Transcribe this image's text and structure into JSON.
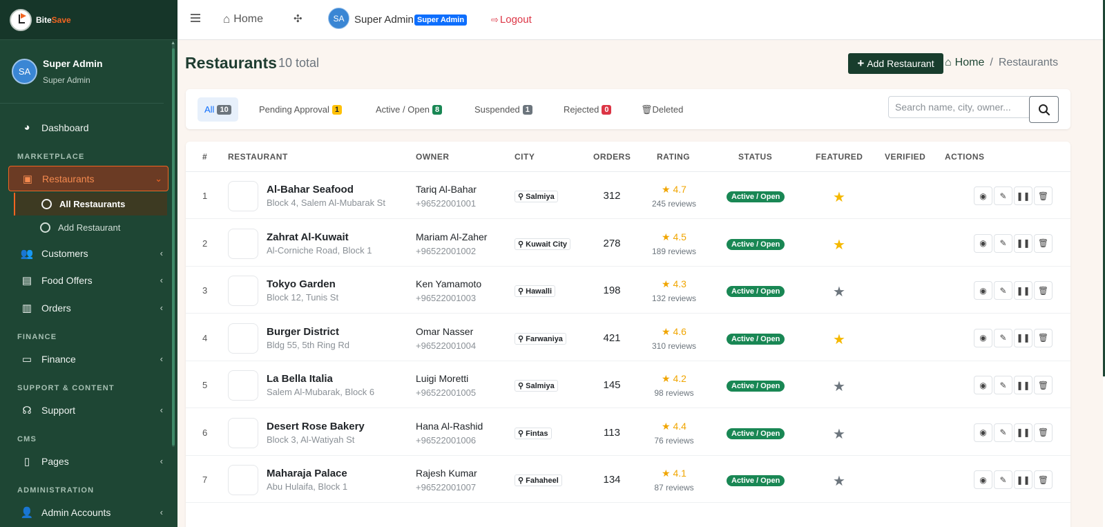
{
  "brand": {
    "name_part1": "Bite",
    "name_part2": "Save"
  },
  "sidebar": {
    "user": {
      "initials": "SA",
      "name": "Super Admin",
      "role": "Super Admin"
    },
    "dashboard": "Dashboard",
    "sections": {
      "marketplace": "MARKETPLACE",
      "finance": "FINANCE",
      "support": "SUPPORT & CONTENT",
      "cms": "CMS",
      "administration": "ADMINISTRATION"
    },
    "items": {
      "restaurants": "Restaurants",
      "all_restaurants": "All Restaurants",
      "add_restaurant": "Add Restaurant",
      "customers": "Customers",
      "food_offers": "Food Offers",
      "orders": "Orders",
      "finance": "Finance",
      "support": "Support",
      "pages": "Pages",
      "admin_accounts": "Admin Accounts"
    }
  },
  "topbar": {
    "home": "Home",
    "user_initials": "SA",
    "user_name": "Super Admin",
    "user_badge": "Super Admin",
    "logout": "Logout"
  },
  "page": {
    "title": "Restaurants",
    "count": "10 total",
    "add_button": "Add Restaurant",
    "breadcrumb": {
      "home": "Home",
      "separator": "/",
      "current": "Restaurants"
    }
  },
  "filters": {
    "tabs": [
      {
        "label": "All",
        "count": "10"
      },
      {
        "label": "Pending Approval",
        "count": "1"
      },
      {
        "label": "Active / Open",
        "count": "8"
      },
      {
        "label": "Suspended",
        "count": "1"
      },
      {
        "label": "Rejected",
        "count": "0"
      },
      {
        "label": "Deleted"
      }
    ],
    "search_placeholder": "Search name, city, owner..."
  },
  "table": {
    "headers": {
      "num": "#",
      "restaurant": "RESTAURANT",
      "owner": "OWNER",
      "city": "CITY",
      "orders": "ORDERS",
      "rating": "RATING",
      "status": "STATUS",
      "featured": "FEATURED",
      "verified": "VERIFIED",
      "actions": "ACTIONS"
    },
    "rows": [
      {
        "num": "1",
        "name": "Al-Bahar Seafood",
        "address": "Block 4, Salem Al-Mubarak St",
        "owner": "Tariq Al-Bahar",
        "phone": "+96522001001",
        "city": "Salmiya",
        "orders": "312",
        "rating": "★ 4.7",
        "reviews": "245 reviews",
        "status": "Active / Open",
        "featured": true
      },
      {
        "num": "2",
        "name": "Zahrat Al-Kuwait",
        "address": "Al-Corniche Road, Block 1",
        "owner": "Mariam Al-Zaher",
        "phone": "+96522001002",
        "city": "Kuwait City",
        "orders": "278",
        "rating": "★ 4.5",
        "reviews": "189 reviews",
        "status": "Active / Open",
        "featured": true
      },
      {
        "num": "3",
        "name": "Tokyo Garden",
        "address": "Block 12, Tunis St",
        "owner": "Ken Yamamoto",
        "phone": "+96522001003",
        "city": "Hawalli",
        "orders": "198",
        "rating": "★ 4.3",
        "reviews": "132 reviews",
        "status": "Active / Open",
        "featured": false
      },
      {
        "num": "4",
        "name": "Burger District",
        "address": "Bldg 55, 5th Ring Rd",
        "owner": "Omar Nasser",
        "phone": "+96522001004",
        "city": "Farwaniya",
        "orders": "421",
        "rating": "★ 4.6",
        "reviews": "310 reviews",
        "status": "Active / Open",
        "featured": true
      },
      {
        "num": "5",
        "name": "La Bella Italia",
        "address": "Salem Al-Mubarak, Block 6",
        "owner": "Luigi Moretti",
        "phone": "+96522001005",
        "city": "Salmiya",
        "orders": "145",
        "rating": "★ 4.2",
        "reviews": "98 reviews",
        "status": "Active / Open",
        "featured": false
      },
      {
        "num": "6",
        "name": "Desert Rose Bakery",
        "address": "Block 3, Al-Watiyah St",
        "owner": "Hana Al-Rashid",
        "phone": "+96522001006",
        "city": "Fintas",
        "orders": "113",
        "rating": "★ 4.4",
        "reviews": "76 reviews",
        "status": "Active / Open",
        "featured": false
      },
      {
        "num": "7",
        "name": "Maharaja Palace",
        "address": "Abu Hulaifa, Block 1",
        "owner": "Rajesh Kumar",
        "phone": "+96522001007",
        "city": "Fahaheel",
        "orders": "134",
        "rating": "★ 4.1",
        "reviews": "87 reviews",
        "status": "Active / Open",
        "featured": false
      }
    ]
  },
  "icons": {
    "view": "eye-icon",
    "edit": "edit-icon",
    "suspend": "pause-icon",
    "delete": "trash-icon",
    "featured_on": "star-filled-icon",
    "featured_off": "star-gray-icon"
  },
  "colors": {
    "sidebar_bg": "#1e4634",
    "accent": "#f26522",
    "primary": "#0d6efd",
    "success": "#198754",
    "danger": "#dc3545",
    "star": "#f5b800"
  }
}
